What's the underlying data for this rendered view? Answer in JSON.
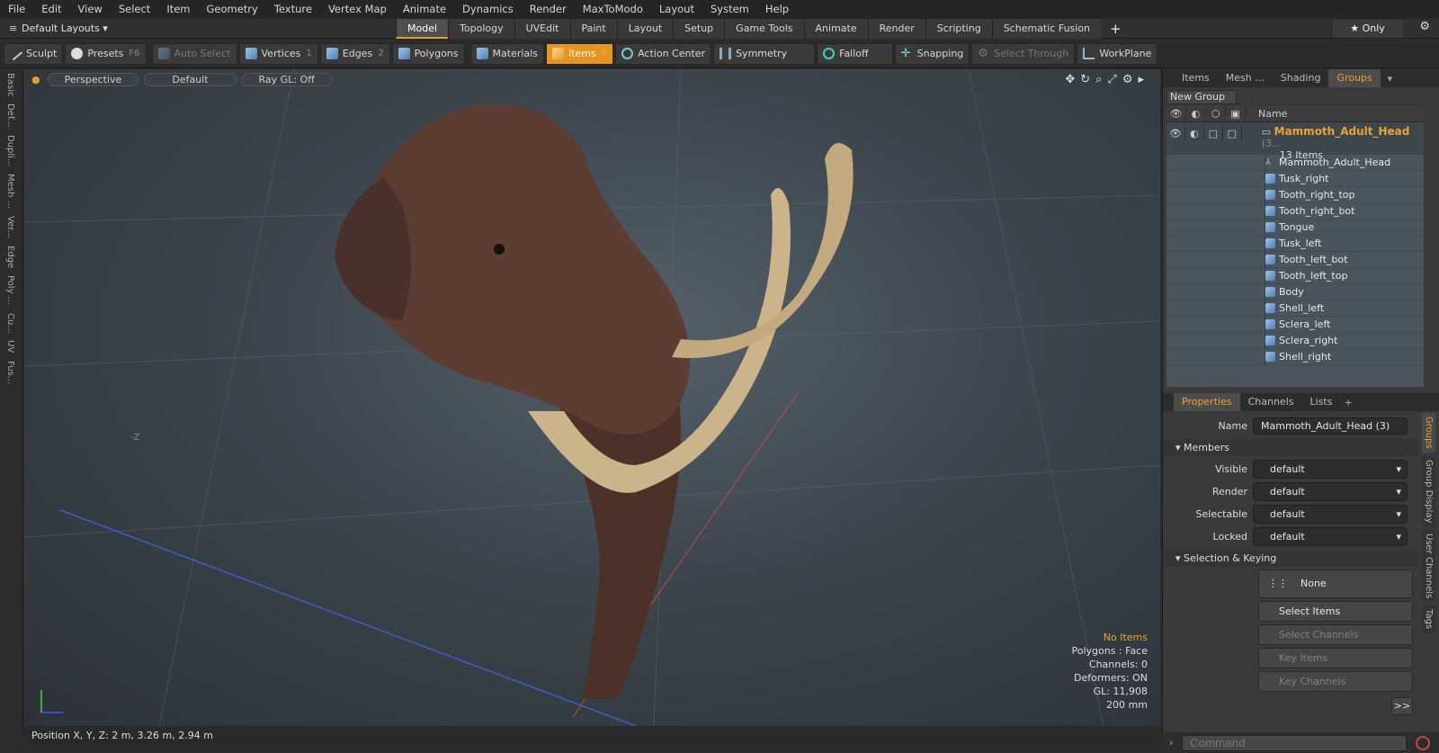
{
  "menu": [
    "File",
    "Edit",
    "View",
    "Select",
    "Item",
    "Geometry",
    "Texture",
    "Vertex Map",
    "Animate",
    "Dynamics",
    "Render",
    "MaxToModo",
    "Layout",
    "System",
    "Help"
  ],
  "layout_selector": "Default Layouts ▾",
  "main_tabs": [
    "Model",
    "Topology",
    "UVEdit",
    "Paint",
    "Layout",
    "Setup",
    "Game Tools",
    "Animate",
    "Render",
    "Scripting",
    "Schematic Fusion"
  ],
  "active_tab": "Model",
  "only_label": "★ Only",
  "toolbar": {
    "sculpt": "Sculpt",
    "presets": "Presets",
    "presets_key": "F6",
    "auto_select": "Auto Select",
    "vertices": "Vertices",
    "vertices_key": "1",
    "edges": "Edges",
    "edges_key": "2",
    "polygons": "Polygons",
    "materials": "Materials",
    "items": "Items",
    "items_key": "5",
    "action_center": "Action Center",
    "symmetry": "Symmetry",
    "falloff": "Falloff",
    "snapping": "Snapping",
    "select_through": "Select Through",
    "workplane": "WorkPlane"
  },
  "left_tabs": [
    "Basic",
    "Def...",
    "Dupli...",
    "Mesh ...",
    "Ver...",
    "Edge",
    "Poly ...",
    "Cu...",
    "UV",
    "Fus..."
  ],
  "viewport": {
    "view": "Perspective",
    "shading": "Default",
    "raygl": "Ray GL: Off",
    "info": {
      "selection": "No Items",
      "polygons": "Polygons : Face",
      "channels": "Channels: 0",
      "deformers": "Deformers: ON",
      "gl": "GL: 11,908",
      "scale": "200 mm"
    },
    "axis_z": "-Z"
  },
  "status": "Position X, Y, Z:   2 m, 3.26 m, 2.94 m",
  "right_top_tabs": [
    "Items",
    "Mesh ...",
    "Shading",
    "Groups"
  ],
  "right_top_active": "Groups",
  "new_group": "New Group",
  "tree": {
    "name_col": "Name",
    "group_name": "Mammoth_Adult_Head",
    "group_suffix": " (3...",
    "group_count": "13 Items",
    "items": [
      "Mammoth_Adult_Head",
      "Tusk_right",
      "Tooth_right_top",
      "Tooth_right_bot",
      "Tongue",
      "Tusk_left",
      "Tooth_left_bot",
      "Tooth_left_top",
      "Body",
      "Shell_left",
      "Sclera_left",
      "Sclera_right",
      "Shell_right"
    ]
  },
  "props_tabs": [
    "Properties",
    "Channels",
    "Lists"
  ],
  "props_active": "Properties",
  "props": {
    "name_label": "Name",
    "name_value": "Mammoth_Adult_Head (3)",
    "members": "Members",
    "visible_label": "Visible",
    "visible_value": "default",
    "render_label": "Render",
    "render_value": "default",
    "selectable_label": "Selectable",
    "selectable_value": "default",
    "locked_label": "Locked",
    "locked_value": "default",
    "sel_keying": "Selection & Keying",
    "none": "None",
    "select_items": "Select Items",
    "select_channels": "Select Channels",
    "key_items": "Key Items",
    "key_channels": "Key Channels",
    "more": ">>"
  },
  "side_tabs": [
    "Groups",
    "Group Display",
    "User Channels",
    "Tags"
  ],
  "command_placeholder": "Command"
}
